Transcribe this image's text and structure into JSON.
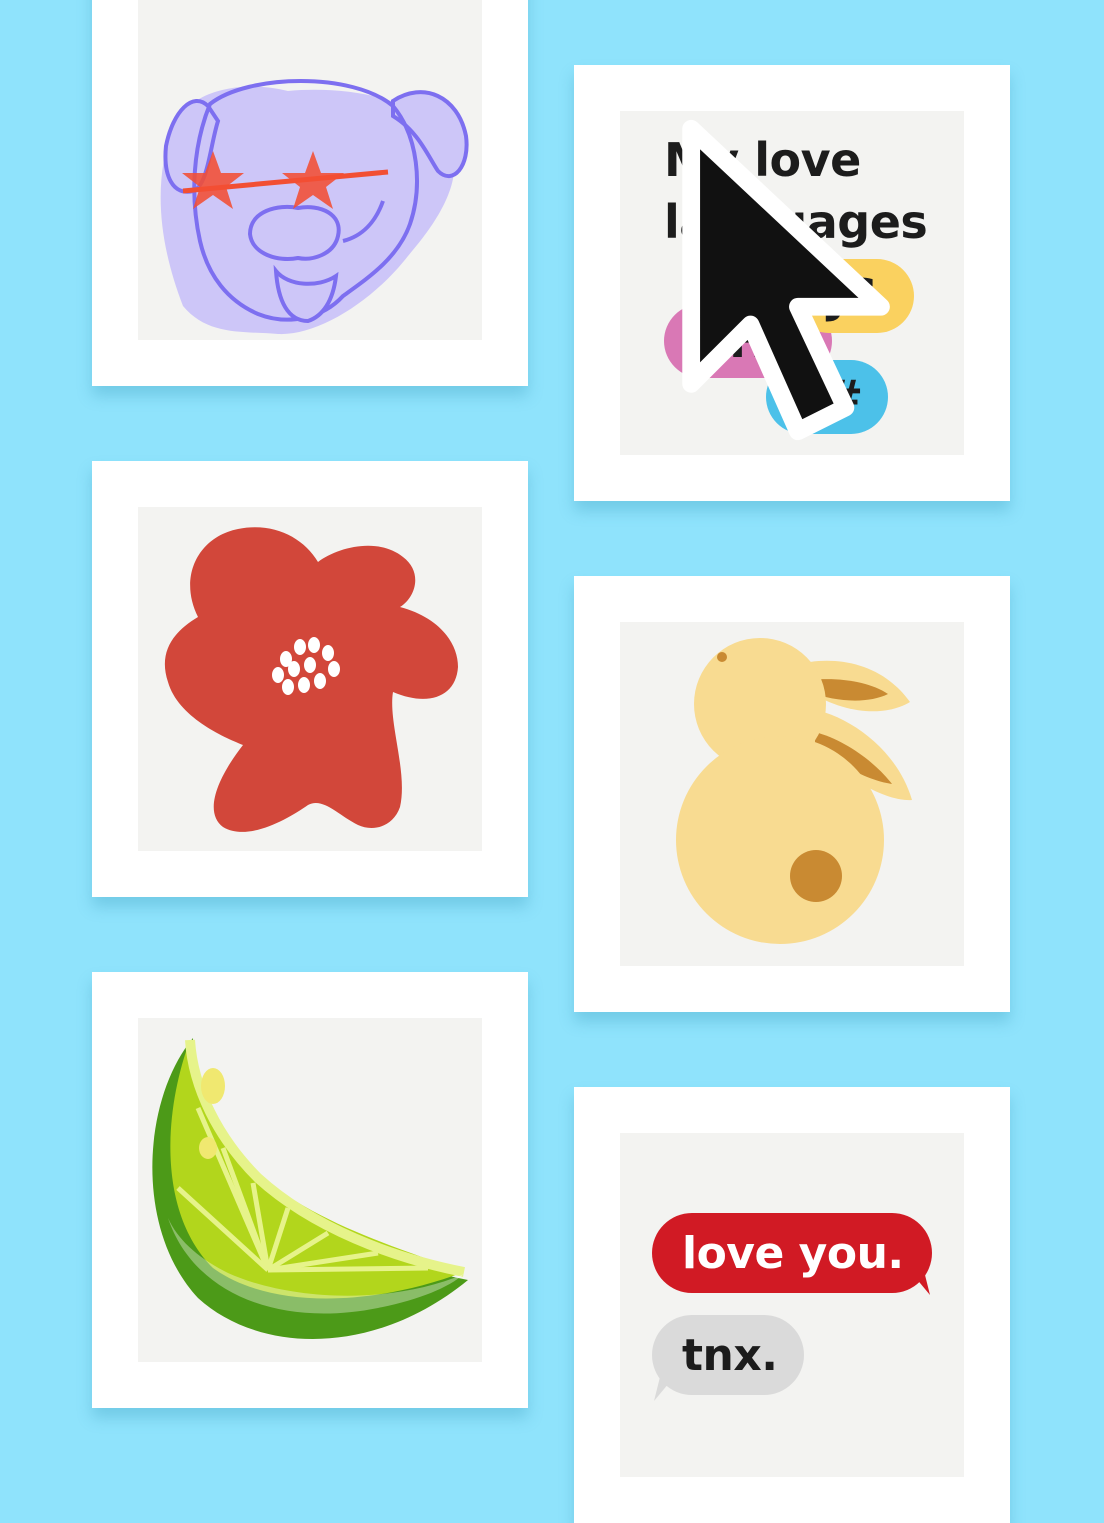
{
  "colors": {
    "background": "#8fe3fc",
    "card": "#ffffff",
    "art_background": "#f3f3f1",
    "dog": "#7d6ff0",
    "dog_fill": "#cdc6f8",
    "glasses": "#f24f33",
    "flower": "#d2473a",
    "bunny": "#f8db91",
    "bunny_accent": "#c98a32",
    "lime_rind": "#4c9a18",
    "lime_flesh": "#b2d61c",
    "php_pill": "#d978b5",
    "js_pill": "#fad15f",
    "csharp_pill": "#4cc1e9",
    "love_bubble": "#d11a24",
    "tnx_bubble": "#dadada"
  },
  "cards": [
    {
      "id": "dog",
      "icon": "dog-with-star-glasses-illustration"
    },
    {
      "id": "love-languages",
      "icon": "programming-language-pills-illustration"
    },
    {
      "id": "flower",
      "icon": "red-flower-illustration"
    },
    {
      "id": "bunny",
      "icon": "bunny-illustration"
    },
    {
      "id": "lime",
      "icon": "lime-slice-illustration"
    },
    {
      "id": "chat",
      "icon": "chat-bubbles-illustration"
    }
  ],
  "love_languages": {
    "title_line1": "My love",
    "title_line2": "languages",
    "pills": {
      "php": "PHP",
      "js": "JS",
      "csharp": "C#"
    }
  },
  "chat": {
    "message_sent": "love you.",
    "message_reply": "tnx."
  }
}
